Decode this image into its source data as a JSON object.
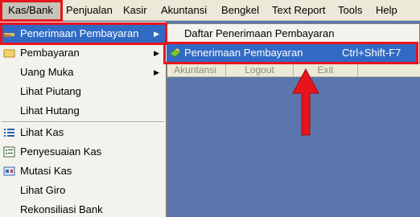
{
  "menubar": {
    "items": [
      {
        "label": "Kas/Bank"
      },
      {
        "label": "Penjualan"
      },
      {
        "label": "Kasir"
      },
      {
        "label": "Akuntansi"
      },
      {
        "label": "Bengkel"
      },
      {
        "label": "Text Report"
      },
      {
        "label": "Tools"
      },
      {
        "label": "Help"
      }
    ]
  },
  "dropdown": {
    "items": [
      {
        "label": "Penerimaan Pembayaran",
        "icon": "hand-money-icon"
      },
      {
        "label": "Pembayaran",
        "icon": "folder-icon"
      },
      {
        "label": "Uang Muka"
      },
      {
        "label": "Lihat Piutang"
      },
      {
        "label": "Lihat Hutang"
      },
      {
        "label": "Lihat Kas",
        "icon": "list-icon"
      },
      {
        "label": "Penyesuaian Kas",
        "icon": "form-icon"
      },
      {
        "label": "Mutasi Kas",
        "icon": "transfer-icon"
      },
      {
        "label": "Lihat Giro"
      },
      {
        "label": "Rekonsiliasi Bank"
      }
    ]
  },
  "submenu": {
    "items": [
      {
        "label": "Daftar Penerimaan Pembayaran",
        "shortcut": ""
      },
      {
        "label": "Penerimaan Pembayaran",
        "shortcut": "Ctrl+Shift-F7"
      }
    ]
  },
  "toolbar": {
    "items": [
      {
        "label": "Akuntansi"
      },
      {
        "label": "Logout"
      },
      {
        "label": "Exit"
      }
    ]
  },
  "colors": {
    "highlight": "#e8141c",
    "selection": "#316ac5",
    "desktop": "#5b76ad"
  }
}
